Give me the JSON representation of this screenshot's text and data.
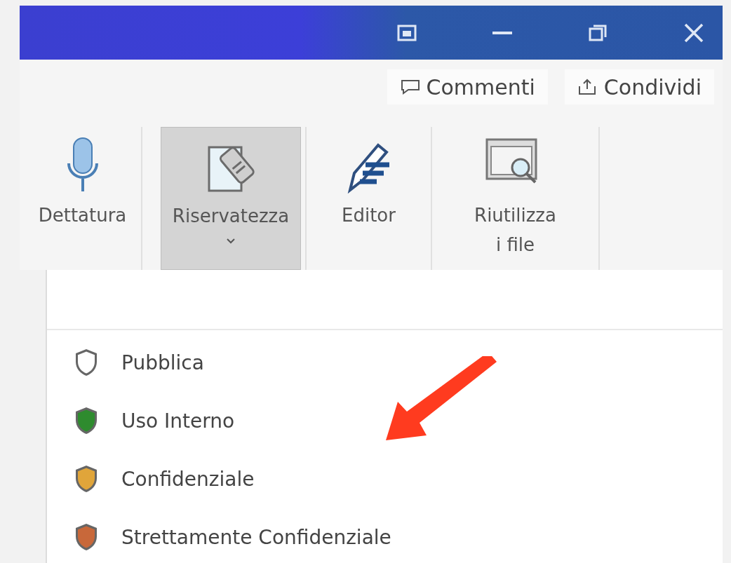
{
  "top_buttons": [
    {
      "label": "Commenti",
      "kind": "comment"
    },
    {
      "label": "Condividi",
      "kind": "share"
    }
  ],
  "ribbon": {
    "buttons": [
      {
        "label": "Dettatura",
        "kind": "mic",
        "selected": false,
        "dropdown": false
      },
      {
        "label": "Riservatezza",
        "kind": "tag",
        "selected": true,
        "dropdown": true
      },
      {
        "label": "Editor",
        "kind": "pen",
        "selected": false,
        "dropdown": false
      },
      {
        "label": "Riutilizza\ni file",
        "kind": "reuse",
        "selected": false,
        "dropdown": false
      }
    ]
  },
  "menu": {
    "items": [
      {
        "label": "Pubblica",
        "color": "#ffffff"
      },
      {
        "label": "Uso Interno",
        "color": "#2e8b2e"
      },
      {
        "label": "Confidenziale",
        "color": "#e0a53a"
      },
      {
        "label": "Strettamente Confidenziale",
        "color": "#c8683a"
      }
    ]
  },
  "annotation": {
    "kind": "arrow"
  }
}
